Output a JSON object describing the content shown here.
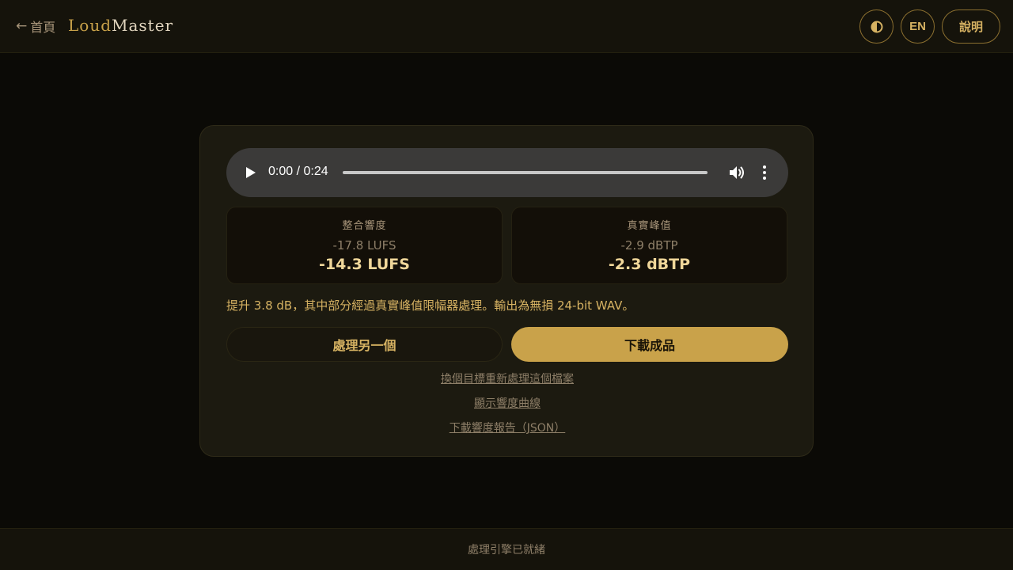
{
  "header": {
    "back_arrow": "←",
    "back_label": "首頁",
    "brand_part1": "Loud",
    "brand_part2": "Master",
    "theme_icon": "half-circle-contrast-icon",
    "lang_label": "EN",
    "help_label": "說明"
  },
  "player": {
    "time": "0:00 / 0:24",
    "progress": 0
  },
  "stats": {
    "loudness": {
      "label": "整合響度",
      "before": "-17.8 LUFS",
      "after": "-14.3 LUFS"
    },
    "peak": {
      "label": "真實峰值",
      "before": "-2.9 dBTP",
      "after": "-2.3 dBTP"
    }
  },
  "summary": "提升 3.8 dB，其中部分經過真實峰值限幅器處理。輸出為無損 24-bit WAV。",
  "actions": {
    "process_another": "處理另一個",
    "download": "下載成品"
  },
  "links": {
    "reprocess": "換個目標重新處理這個檔案",
    "show_curve": "顯示響度曲線",
    "download_report": "下載響度報告（JSON）"
  },
  "footer": {
    "status": "處理引擎已就緒"
  },
  "colors": {
    "accent": "#c9a24a",
    "background": "#0b0a06",
    "card": "#1c1a10"
  }
}
